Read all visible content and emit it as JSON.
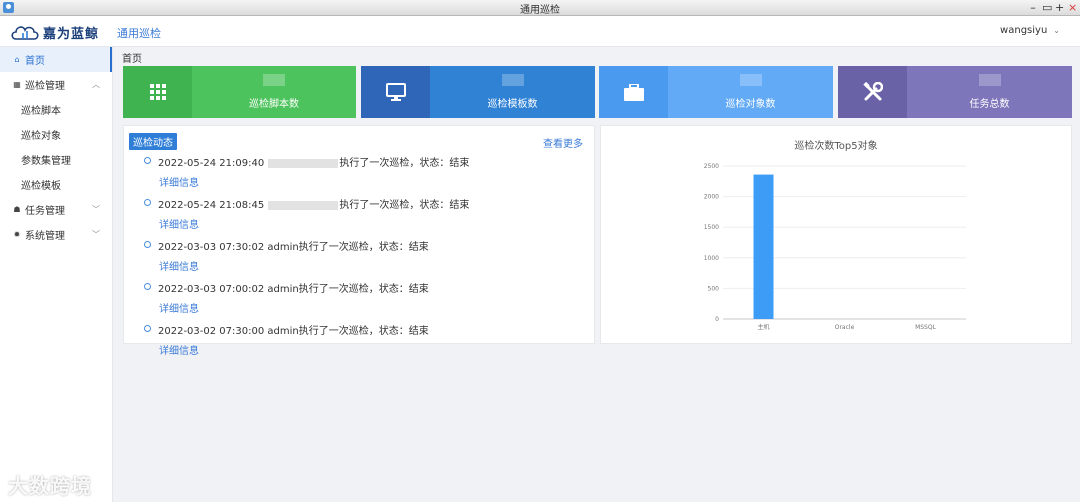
{
  "window": {
    "title": "通用巡检",
    "buttons": [
      "–",
      "▭",
      "+",
      "×"
    ]
  },
  "header": {
    "logo_text": "嘉为蓝鲸",
    "app_title": "通用巡检",
    "username": "wangsiyu",
    "user_chevron": "⌄"
  },
  "sidebar": {
    "items": [
      {
        "label": "首页",
        "icon": "home-icon",
        "active": true
      },
      {
        "label": "巡检管理",
        "icon": "grid-icon",
        "expanded": true
      },
      {
        "label": "巡检脚本",
        "sub": true
      },
      {
        "label": "巡检对象",
        "sub": true
      },
      {
        "label": "参数集管理",
        "sub": true
      },
      {
        "label": "巡检模板",
        "sub": true
      },
      {
        "label": "任务管理",
        "icon": "house-icon",
        "expanded": false
      },
      {
        "label": "系统管理",
        "icon": "gear-icon",
        "expanded": false
      }
    ]
  },
  "breadcrumb": "首页",
  "stats": [
    {
      "label": "巡检脚本数",
      "icon": "apps-grid-icon",
      "icon_bg": "#3fb34f",
      "body_bg": "#4cc35c"
    },
    {
      "label": "巡检模板数",
      "icon": "monitor-icon",
      "icon_bg": "#2f66b8",
      "body_bg": "#2f82d4"
    },
    {
      "label": "巡检对象数",
      "icon": "briefcase-icon",
      "icon_bg": "#4a9bf0",
      "body_bg": "#62aaf6"
    },
    {
      "label": "任务总数",
      "icon": "tools-icon",
      "icon_bg": "#6a62a6",
      "body_bg": "#7d76bb"
    }
  ],
  "activity": {
    "tag": "巡检动态",
    "more_label": "查看更多",
    "items": [
      {
        "time": "2022-05-24 21:09:40",
        "user": "",
        "redacted": true,
        "text": "执行了一次巡检，状态：结束",
        "detail": "详细信息"
      },
      {
        "time": "2022-05-24 21:08:45",
        "user": "",
        "redacted": true,
        "text": "执行了一次巡检，状态：结束",
        "detail": "详细信息"
      },
      {
        "time": "2022-03-03 07:30:02",
        "user": "admin",
        "redacted": false,
        "text": "执行了一次巡检，状态：结束",
        "detail": "详细信息"
      },
      {
        "time": "2022-03-03 07:00:02",
        "user": "admin",
        "redacted": false,
        "text": "执行了一次巡检，状态：结束",
        "detail": "详细信息"
      },
      {
        "time": "2022-03-02 07:30:00",
        "user": "admin",
        "redacted": false,
        "text": "执行了一次巡检，状态：结束",
        "detail": "详细信息"
      }
    ]
  },
  "chart_data": {
    "type": "bar",
    "title": "巡检次数Top5对象",
    "categories": [
      "主机",
      "Oracle",
      "MSSQL"
    ],
    "values": [
      2360,
      0,
      0
    ],
    "yticks": [
      0,
      500,
      1000,
      1500,
      2000,
      2500
    ],
    "ylim": [
      0,
      2500
    ],
    "grid": true,
    "bar_color": "#3d9cf5"
  },
  "watermark": "大数跨境"
}
